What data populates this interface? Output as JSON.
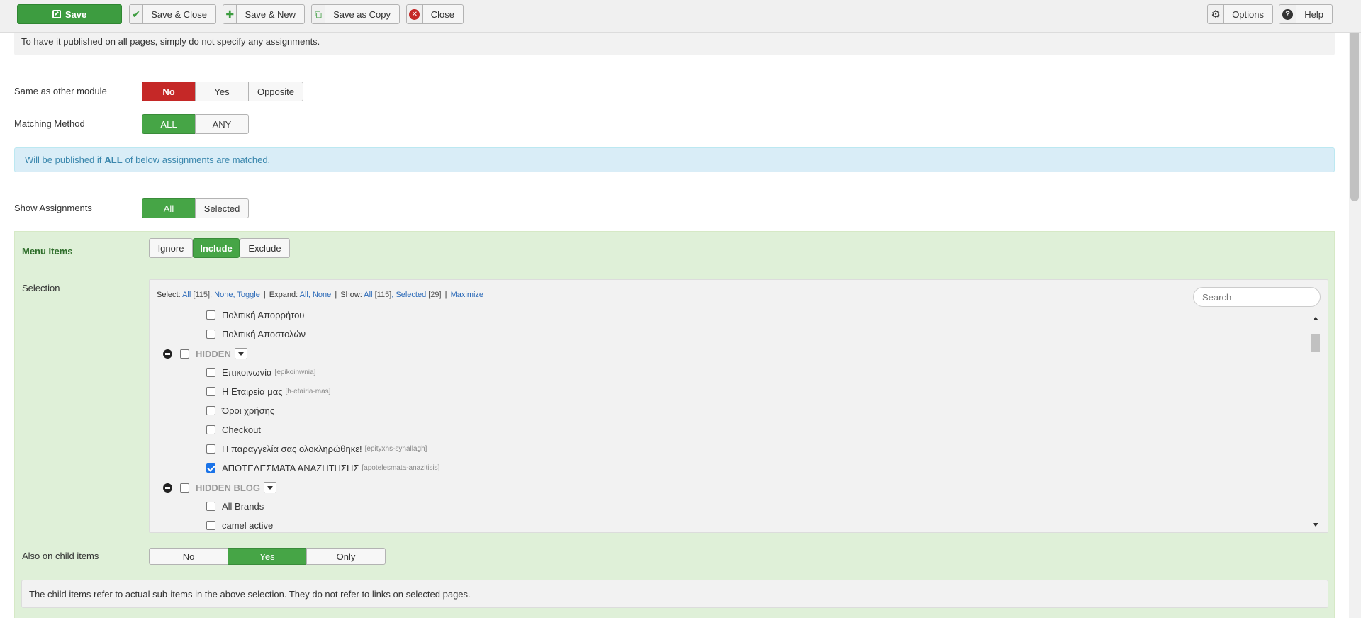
{
  "toolbar": {
    "save": "Save",
    "save_close": "Save & Close",
    "save_new": "Save & New",
    "save_copy": "Save as Copy",
    "close": "Close",
    "options": "Options",
    "help": "Help"
  },
  "top_notice": "To have it published on all pages, simply do not specify any assignments.",
  "same_as_other": {
    "label": "Same as other module",
    "options": [
      "No",
      "Yes",
      "Opposite"
    ],
    "selected": "No"
  },
  "matching_method": {
    "label": "Matching Method",
    "options": [
      "ALL",
      "ANY"
    ],
    "selected": "ALL"
  },
  "info": {
    "prefix": "Will be published if",
    "emphasis": "ALL",
    "suffix": "of below assignments are matched."
  },
  "show_assignments": {
    "label": "Show Assignments",
    "options": [
      "All",
      "Selected"
    ],
    "selected": "All"
  },
  "menu_items": {
    "title": "Menu Items",
    "mode_options": [
      "Ignore",
      "Include",
      "Exclude"
    ],
    "mode_selected": "Include",
    "selection_label": "Selection",
    "toolbar": {
      "select_label": "Select:",
      "all": "All",
      "all_count": "[115]",
      "none": "None",
      "toggle": "Toggle",
      "expand_label": "Expand:",
      "expand_all": "All",
      "expand_none": "None",
      "show_label": "Show:",
      "show_all": "All",
      "show_all_count": "[115]",
      "selected": "Selected",
      "selected_count": "[29]",
      "maximize": "Maximize"
    },
    "search_placeholder": "Search",
    "items": [
      {
        "label": "Πολιτική Αποστολών",
        "alias": "",
        "checked": false
      },
      {
        "group": "HIDDEN"
      },
      {
        "label": "Επικοινωνία",
        "alias": "[epikoinwnia]",
        "checked": false
      },
      {
        "label": "Η Εταιρεία μας",
        "alias": "[h-etairia-mas]",
        "checked": false
      },
      {
        "label": "Όροι χρήσης",
        "alias": "",
        "checked": false
      },
      {
        "label": "Checkout",
        "alias": "",
        "checked": false
      },
      {
        "label": "Η παραγγελία σας ολοκληρώθηκε!",
        "alias": "[epityxhs-synallagh]",
        "checked": false
      },
      {
        "label": "ΑΠΟΤΕΛΕΣΜΑΤΑ ΑΝΑΖΗΤΗΣΗΣ",
        "alias": "[apotelesmata-anazitisis]",
        "checked": true
      },
      {
        "group": "HIDDEN BLOG"
      },
      {
        "label": "All Brands",
        "alias": "",
        "checked": false
      },
      {
        "label": "camel active",
        "alias": "",
        "checked": false
      }
    ],
    "partial_top_item": "Πολιτική Απορρήτου"
  },
  "child_items": {
    "label": "Also on child items",
    "options": [
      "No",
      "Yes",
      "Only"
    ],
    "selected": "Yes",
    "note": "The child items refer to actual sub-items in the above selection. They do not refer to links on selected pages."
  },
  "colors": {
    "green": "#46a546",
    "red": "#c52827",
    "info_bg": "#d9edf7",
    "panel_bg": "#dff0d8"
  }
}
